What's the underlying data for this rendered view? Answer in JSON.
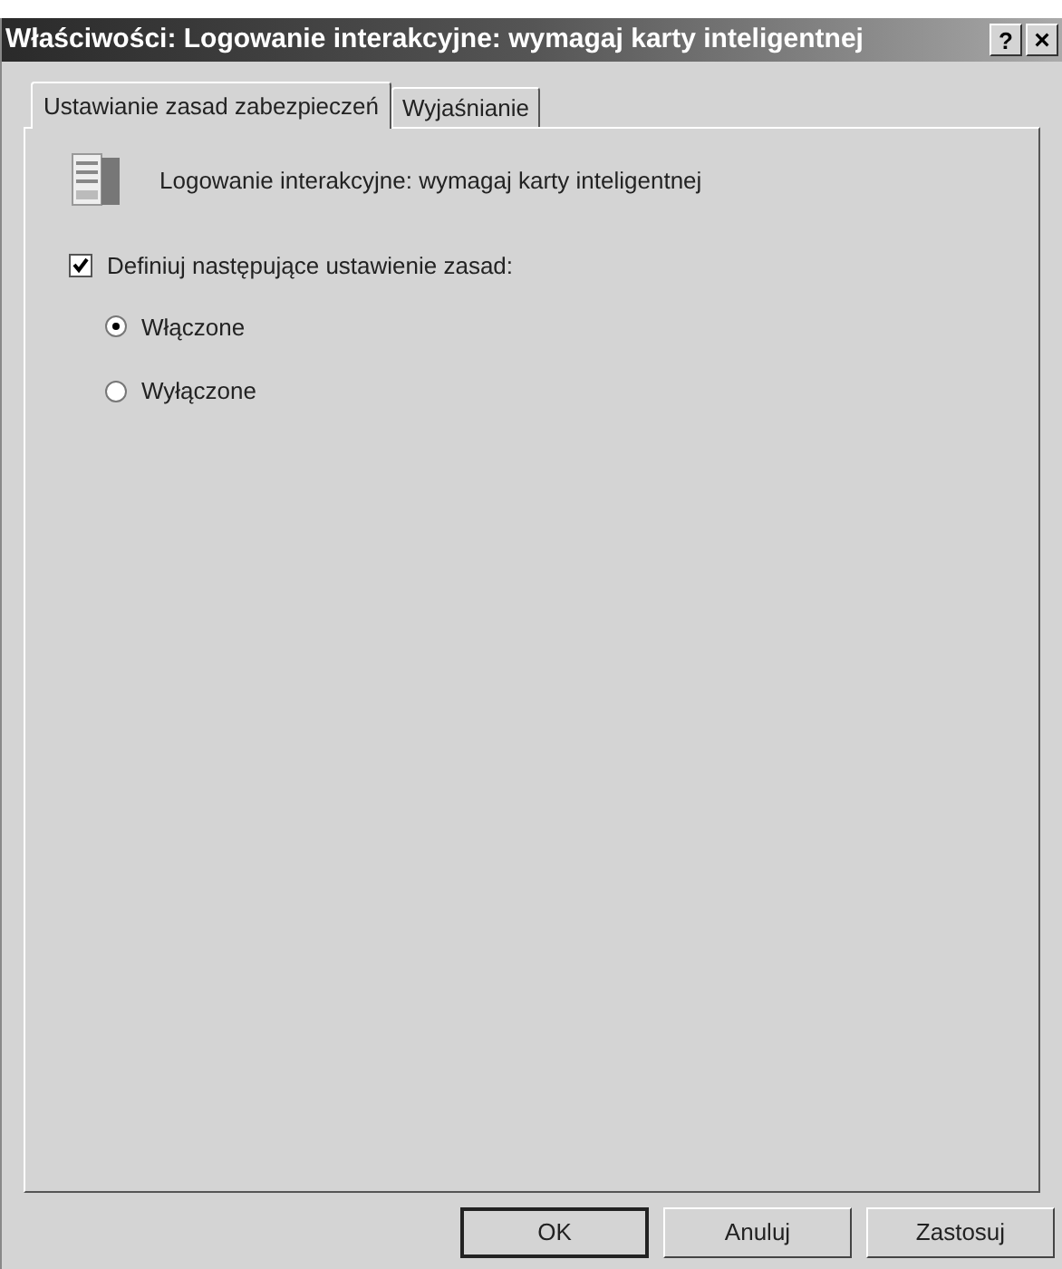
{
  "window": {
    "title": "Właściwości: Logowanie interakcyjne: wymagaj karty inteligentnej",
    "help": "?",
    "close": "×"
  },
  "tabs": [
    {
      "label": "Ustawianie zasad zabezpieczeń",
      "selected": true
    },
    {
      "label": "Wyjaśnianie",
      "selected": false
    }
  ],
  "policy_name": "Logowanie interakcyjne: wymagaj karty inteligentnej",
  "define": {
    "label": "Definiuj następujące ustawienie zasad:",
    "checked": true
  },
  "options": [
    {
      "label": "Włączone",
      "selected": true
    },
    {
      "label": "Wyłączone",
      "selected": false
    }
  ],
  "buttons": [
    {
      "label": "OK",
      "default": true
    },
    {
      "label": "Anuluj",
      "default": false
    },
    {
      "label": "Zastosuj",
      "default": false
    }
  ]
}
